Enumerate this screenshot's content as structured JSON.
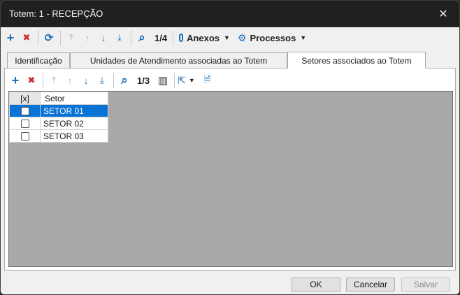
{
  "window": {
    "title": "Totem: 1 - RECEPÇÃO",
    "close_glyph": "✕"
  },
  "toolbar": {
    "add_icon": "+",
    "delete_icon": "✖",
    "refresh_icon": "⟳",
    "first_icon": "⤒",
    "up_icon": "↑",
    "down_icon": "↓",
    "last_icon": "⤓",
    "search_icon": "⌕",
    "counter": "1/4",
    "attachments_label": "Anexos",
    "processes_label": "Processos",
    "caret": "▼"
  },
  "tabs": [
    {
      "label": "Identificação",
      "active": false
    },
    {
      "label": "Unidades de Atendimento associadas ao Totem",
      "active": false
    },
    {
      "label": "Setores associados ao Totem",
      "active": true
    }
  ],
  "inner_toolbar": {
    "add_icon": "+",
    "delete_icon": "✖",
    "first_icon": "⤒",
    "up_icon": "↑",
    "down_icon": "↓",
    "last_icon": "⤓",
    "search_icon": "⌕",
    "counter": "1/3",
    "columns_icon": "▥",
    "export_icon": "⇱",
    "caret": "▼",
    "report_icon": "🗎"
  },
  "grid": {
    "columns": [
      "[x]",
      "Setor"
    ],
    "rows": [
      {
        "checked": false,
        "setor": "SETOR 01",
        "selected": true
      },
      {
        "checked": false,
        "setor": "SETOR 02",
        "selected": false
      },
      {
        "checked": false,
        "setor": "SETOR 03",
        "selected": false
      }
    ]
  },
  "footer": {
    "ok": "OK",
    "cancel": "Cancelar",
    "save": "Salvar"
  },
  "colors": {
    "accent": "#0a73d6",
    "add": "#1a6fb8",
    "delete": "#cc2a2a",
    "grid_background": "#a9a9a9"
  }
}
